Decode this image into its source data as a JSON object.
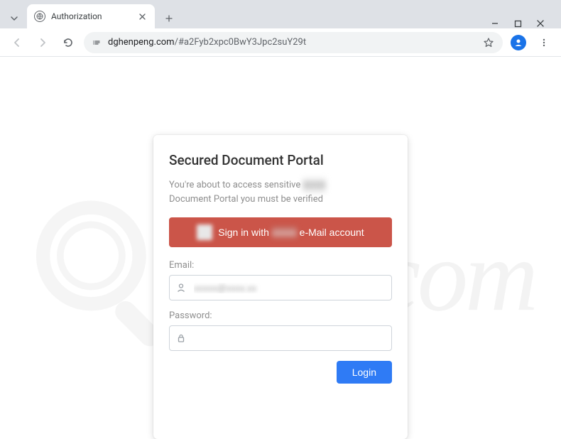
{
  "browser": {
    "tab_title": "Authorization",
    "url_domain": "dghenpeng.com",
    "url_path": "/#a2Fyb2xpc0BwY3Jpc2suY29t"
  },
  "portal": {
    "title": "Secured Document Portal",
    "desc_line1_a": "You're about to access sensitive ",
    "desc_line1_blur": "xxxxx",
    "desc_line2": "Document Portal you must be verified",
    "sso_prefix": "Sign in with ",
    "sso_blur": "xxxxx",
    "sso_suffix": " e-Mail account",
    "email_label": "Email:",
    "email_value": "xxxxx@xxxx.xx",
    "password_label": "Password:",
    "password_value": "",
    "login_label": "Login"
  },
  "watermark": {
    "text": "risk.com"
  }
}
